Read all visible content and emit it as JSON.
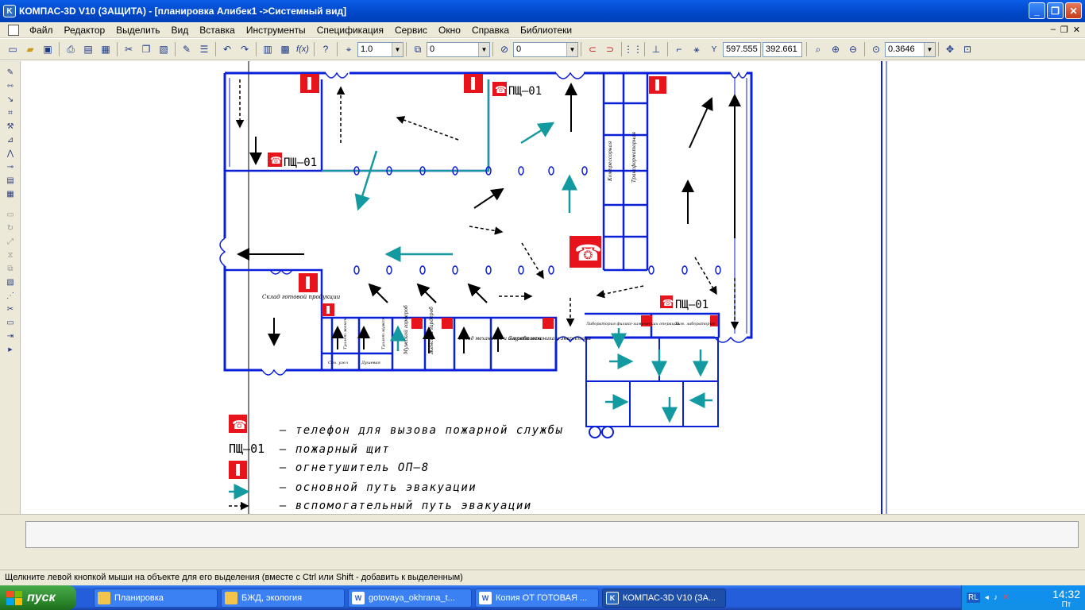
{
  "window": {
    "title": "КОМПАС-3D V10 (ЗАЩИТА) - [планировка Алибек1 ->Системный вид]",
    "app_icon": "K"
  },
  "menu": [
    "Файл",
    "Редактор",
    "Выделить",
    "Вид",
    "Вставка",
    "Инструменты",
    "Спецификация",
    "Сервис",
    "Окно",
    "Справка",
    "Библиотеки"
  ],
  "toolbar": {
    "line_step": "1.0",
    "layer_value": "0",
    "style_value": "0",
    "coord_x": "597.555",
    "coord_y": "392.661",
    "scale_value": "0.3646",
    "fx_label": "f(x)",
    "coord_label": "Y"
  },
  "drawing": {
    "pshch_label": "ПЩ–01",
    "rooms": {
      "sklad": "Склад\nготовой продукции",
      "kompressornaya": "Компрессорная",
      "transformatornaya": "Трансформаторная",
      "lab1": "Лаборатория физико-химических операций",
      "lab2": "Хим. лаборатория",
      "mugi": "Мужской гардероб",
      "zhen": "Женский гардероб",
      "sklad_mech": "Склад механиков и энергетиков",
      "sluzhba": "Служба механика и энергетика",
      "wc1": "Сан. узел",
      "wc2": "Душевая",
      "wc3": "Туалет женск.",
      "wc4": "Туалет мужск."
    }
  },
  "legend": [
    {
      "icon": "phone",
      "text": "– телефон для вызова пожарной службы"
    },
    {
      "icon": "pshch",
      "label": "ПЩ–01",
      "text": "– пожарный щит"
    },
    {
      "icon": "extinguisher",
      "text": "– огнетушитель ОП–8"
    },
    {
      "icon": "teal-arrow",
      "text": "– основной путь эвакуации"
    },
    {
      "icon": "dashed-arrow",
      "text": "– вспомогательный путь эвакуации"
    }
  ],
  "status": "Щелкните левой кнопкой мыши на объекте для его выделения (вместе с Ctrl или Shift - добавить к выделенным)",
  "taskbar": {
    "start": "пуск",
    "tasks": [
      {
        "label": "Планировка",
        "icon": "folder-icon"
      },
      {
        "label": "БЖД, экология",
        "icon": "folder-icon"
      },
      {
        "label": "gotovaya_okhrana_t...",
        "icon": "word-icon"
      },
      {
        "label": "Копия ОТ ГОТОВАЯ ...",
        "icon": "word-icon"
      },
      {
        "label": "КОМПАС-3D V10 (ЗА...",
        "icon": "kompas-icon"
      }
    ],
    "lang": "RL",
    "time": "14:32",
    "day": "Пт"
  },
  "colors": {
    "wall": "#0a1fd8",
    "fire_red": "#e8141c",
    "teal": "#139aa0",
    "title_blue": "#0047c8"
  }
}
